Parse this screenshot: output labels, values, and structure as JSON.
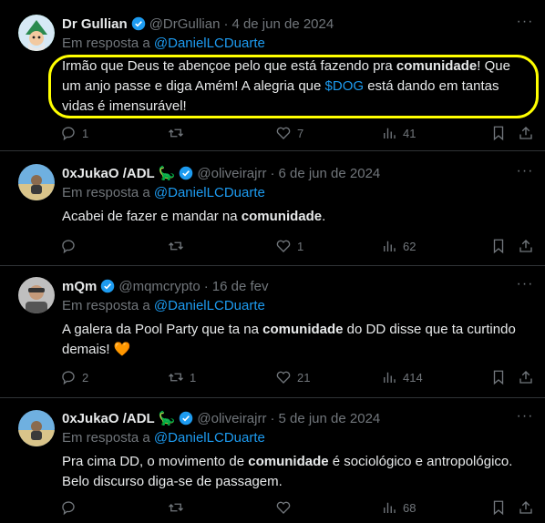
{
  "tweets": [
    {
      "name": "Dr Gullian",
      "handle": "@DrGullian",
      "dot": "·",
      "date": "4 de jun de 2024",
      "reply_prefix": "Em resposta a",
      "reply_to": "@DanielLCDuarte",
      "text_parts": [
        "Irmão que Deus te abençoe pelo que está fazendo pra ",
        "comunidade",
        "! Que um anjo passe e diga Amém! A alegria que ",
        "$DOG",
        " está dando em tantas vidas é imensurável!"
      ],
      "replies": "1",
      "reposts": "",
      "likes": "7",
      "views": "41",
      "highlighted": true,
      "avatar_emoji": "🧙"
    },
    {
      "name": "0xJukaO /ADL",
      "dino": "🦕",
      "handle": "@oliveirajrr",
      "dot": "·",
      "date": "6 de jun de 2024",
      "reply_prefix": "Em resposta a",
      "reply_to": "@DanielLCDuarte",
      "text_parts": [
        "Acabei de fazer e mandar na ",
        "comunidade",
        "."
      ],
      "replies": "",
      "reposts": "",
      "likes": "1",
      "views": "62"
    },
    {
      "name": "mQm",
      "handle": "@mqmcrypto",
      "dot": "·",
      "date": "16 de fev",
      "reply_prefix": "Em resposta a",
      "reply_to": "@DanielLCDuarte",
      "text_parts": [
        "A galera da Pool Party que ta na ",
        "comunidade",
        " do DD disse que ta curtindo demais! ",
        "🧡"
      ],
      "replies": "2",
      "reposts": "1",
      "likes": "21",
      "views": "414"
    },
    {
      "name": "0xJukaO /ADL",
      "dino": "🦕",
      "handle": "@oliveirajrr",
      "dot": "·",
      "date": "5 de jun de 2024",
      "reply_prefix": "Em resposta a",
      "reply_to": "@DanielLCDuarte",
      "text_parts": [
        "Pra cima DD, o movimento de ",
        "comunidade",
        " é sociológico e antropológico. Belo discurso diga-se de passagem."
      ],
      "replies": "",
      "reposts": "",
      "likes": "",
      "views": "68"
    }
  ],
  "more_glyph": "···",
  "colors": {
    "background": "#000000",
    "text": "#e7e9ea",
    "muted": "#71767b",
    "link": "#1d9bf0",
    "separator": "#2f3336",
    "highlight": "#ffff00"
  }
}
